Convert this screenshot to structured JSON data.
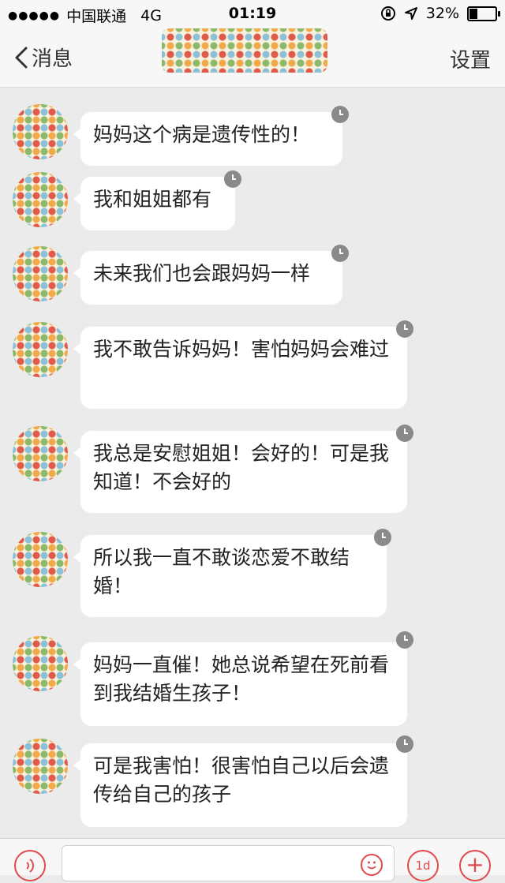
{
  "status_bar": {
    "signal_dots": "●●●●●",
    "carrier": "中国联通",
    "network": "4G",
    "time": "01:19",
    "battery_percent": "32%",
    "battery_level": 0.32
  },
  "nav": {
    "back_label": "消息",
    "settings_label": "设置"
  },
  "messages": [
    {
      "text": "妈妈这个病是遗传性的！"
    },
    {
      "text": "我和姐姐都有"
    },
    {
      "text": "未来我们也会跟妈妈一样"
    },
    {
      "text": "我不敢告诉妈妈！害怕妈妈会难过"
    },
    {
      "text": "我总是安慰姐姐！会好的！可是我知道！不会好的"
    },
    {
      "text": "所以我一直不敢谈恋爱不敢结婚！"
    },
    {
      "text": "妈妈一直催！她总说希望在死前看到我结婚生孩子！"
    },
    {
      "text": "可是我害怕！很害怕自己以后会遗传给自己的孩子"
    }
  ],
  "input_bar": {
    "day_button_label": "1d",
    "plus_label": "+"
  },
  "colors": {
    "accent": "#e04a4a",
    "background": "#ebebeb",
    "bubble": "#ffffff",
    "clock_badge": "#8a8a8a"
  }
}
